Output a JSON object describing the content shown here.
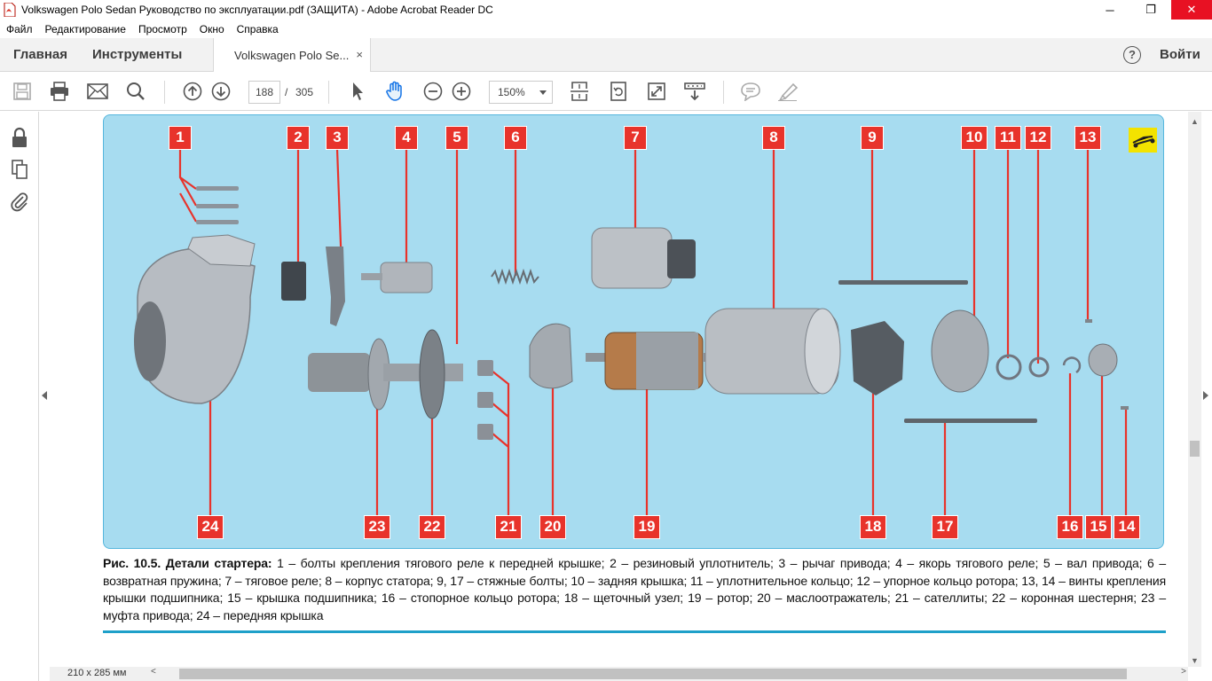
{
  "window": {
    "title": "Volkswagen Polo Sedan Руководство по эксплуатации.pdf (ЗАЩИТА) - Adobe Acrobat Reader DC",
    "minimize": "─",
    "maximize": "❐",
    "close": "✕"
  },
  "menu": [
    "Файл",
    "Редактирование",
    "Просмотр",
    "Окно",
    "Справка"
  ],
  "tabs": {
    "home": "Главная",
    "tools": "Инструменты",
    "document": "Volkswagen Polo Se...",
    "close": "×",
    "help": "?",
    "signin": "Войти"
  },
  "toolbar": {
    "page_current": "188",
    "page_sep": "/",
    "page_total": "305",
    "zoom": "150%"
  },
  "status": {
    "page_size": "210 x 285 мм",
    "scroll_left": "<",
    "scroll_right": ">"
  },
  "figure": {
    "badges_top": [
      "1",
      "2",
      "3",
      "4",
      "5",
      "6",
      "7",
      "8",
      "9",
      "10",
      "11",
      "12",
      "13"
    ],
    "badges_bottom": [
      "24",
      "23",
      "22",
      "21",
      "20",
      "19",
      "18",
      "17",
      "16",
      "15",
      "14"
    ],
    "background_color": "#a7dcf0",
    "badge_color": "#e8332b"
  },
  "caption": {
    "lead": "Рис. 10.5. Детали стартера:",
    "text": " 1 – болты крепления тягового реле к передней крышке; 2 – резиновый уплотнитель; 3 – рычаг привода; 4 – якорь тягового реле; 5 – вал привода; 6 – возвратная пружина; 7 – тяговое реле; 8 – корпус статора; 9, 17 – стяжные болты; 10 – задняя крышка; 11 – уплотнительное кольцо; 12 – упорное кольцо ротора; 13, 14 – винты крепления крышки подшипника; 15 – крышка подшипника; 16 – стопорное кольцо ротора; 18 – щеточный узел; 19 – ротор; 20 – маслоотражатель; 21 – сателлиты; 22 – коронная шестерня; 23 – муфта привода; 24 – передняя крышка"
  }
}
